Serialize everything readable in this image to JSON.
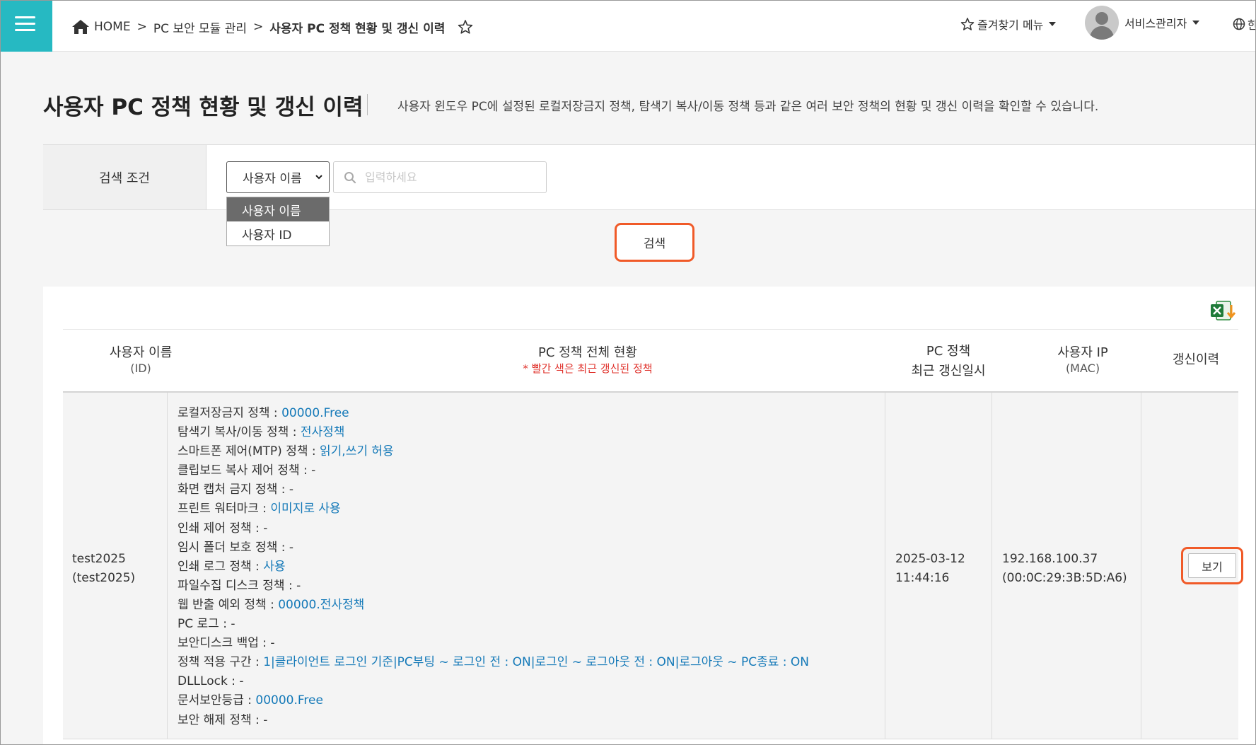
{
  "breadcrumb": {
    "home": "HOME",
    "separator": ">",
    "level1": "PC 보안 모듈 관리",
    "current": "사용자 PC 정책 현황 및 갱신 이력"
  },
  "header": {
    "favorites": "즐겨찾기 메뉴",
    "user": "서비스관리자",
    "language": "한"
  },
  "page": {
    "title": "사용자 PC 정책 현황 및 갱신 이력",
    "description": "사용자 윈도우 PC에 설정된 로컬저장금지 정책, 탐색기 복사/이동 정책 등과 같은 여러 보안 정책의 현황 및 갱신 이력을 확인할 수 있습니다."
  },
  "search": {
    "label": "검색 조건",
    "select_value": "사용자 이름",
    "options": [
      "사용자 이름",
      "사용자 ID"
    ],
    "placeholder": "입력하세요",
    "button": "검색"
  },
  "table": {
    "headers": {
      "name": "사용자 이름",
      "name_sub": "(ID)",
      "policy": "PC 정책 전체 현황",
      "policy_note": "* 빨간 색은 최근 갱신된 정책",
      "updated_1": "PC 정책",
      "updated_2": "최근 갱신일시",
      "ip": "사용자 IP",
      "ip_sub": "(MAC)",
      "history": "갱신이력"
    },
    "rows": [
      {
        "name": "test2025",
        "id": "(test2025)",
        "updated_date": "2025-03-12",
        "updated_time": "11:44:16",
        "ip": "192.168.100.37",
        "mac": "(00:0C:29:3B:5D:A6)",
        "view_button": "보기",
        "policies": [
          {
            "label": "로컬저장금지 정책 : ",
            "value": "00000.Free"
          },
          {
            "label": "탐색기 복사/이동 정책 : ",
            "value": "전사정책"
          },
          {
            "label": "스마트폰 제어(MTP) 정책 : ",
            "value": "읽기,쓰기 허용"
          },
          {
            "label": "클립보드 복사 제어 정책 : ",
            "value": "-"
          },
          {
            "label": "화면 캡처 금지 정책 : ",
            "value": "-"
          },
          {
            "label": "프린트 워터마크 : ",
            "value": "이미지로 사용"
          },
          {
            "label": "인쇄 제어 정책 : ",
            "value": "-"
          },
          {
            "label": "임시 폴더 보호 정책 : ",
            "value": "-"
          },
          {
            "label": "인쇄 로그 정책 : ",
            "value": "사용"
          },
          {
            "label": "파일수집 디스크 정책 : ",
            "value": "-"
          },
          {
            "label": "웹 반출 예외 정책 : ",
            "value": "00000.전사정책"
          },
          {
            "label": "PC 로그 : ",
            "value": "-"
          },
          {
            "label": "보안디스크 백업 : ",
            "value": "-"
          },
          {
            "label": "정책 적용 구간 : ",
            "value": "1|클라이언트 로그인 기준|PC부팅 ~ 로그인 전 : ON|로그인 ~ 로그아웃 전 : ON|로그아웃 ~ PC종료 : ON"
          },
          {
            "label": "DLLLock : ",
            "value": "-"
          },
          {
            "label": "문서보안등급 : ",
            "value": "00000.Free"
          },
          {
            "label": "보안 해제 정책 : ",
            "value": "-"
          }
        ]
      }
    ]
  },
  "colors": {
    "accent": "#26b9c2",
    "highlight_border": "#f05a28",
    "value_text": "#1479b8",
    "note_red": "#e0342e"
  },
  "icons": {
    "menu": "hamburger-icon",
    "home": "home-icon",
    "favorite": "star-icon",
    "search": "search-icon",
    "language": "globe-icon",
    "excel": "excel-download-icon"
  }
}
